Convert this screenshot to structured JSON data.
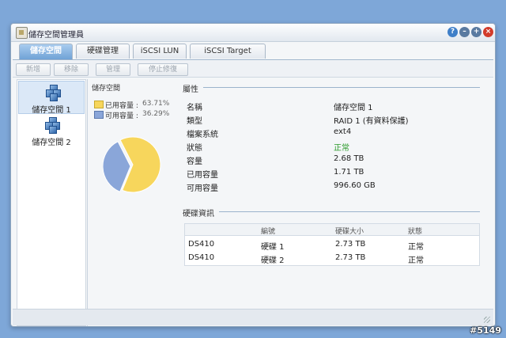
{
  "window": {
    "title": "儲存空間管理員"
  },
  "tabs": [
    {
      "label": "儲存空間"
    },
    {
      "label": "硬碟管理"
    },
    {
      "label": "iSCSI LUN"
    },
    {
      "label": "iSCSI Target"
    }
  ],
  "toolbar": {
    "create": "新增",
    "remove": "移除",
    "manage": "管理",
    "stop_repair": "停止修復"
  },
  "volumes": [
    {
      "label": "儲存空間 1"
    },
    {
      "label": "儲存空間 2"
    }
  ],
  "usage": {
    "title": "儲存空間",
    "used_label": "已用容量 :",
    "used_pct": "63.71%",
    "free_label": "可用容量 :",
    "free_pct": "36.29%",
    "used_color": "#f7d65c",
    "free_color": "#8aa6d9"
  },
  "properties": {
    "title": "屬性",
    "rows": [
      {
        "key": "名稱",
        "value": "儲存空間 1"
      },
      {
        "key": "類型",
        "value": "RAID 1 (有資料保護)"
      },
      {
        "key": "檔案系統",
        "value": "ext4"
      },
      {
        "key": "狀態",
        "value": "正常"
      },
      {
        "key": "容量",
        "value": "2.68 TB"
      },
      {
        "key": "已用容量",
        "value": "1.71 TB"
      },
      {
        "key": "可用容量",
        "value": "996.60 GB"
      }
    ]
  },
  "disks": {
    "title": "硬碟資訊",
    "headers": [
      "",
      "編號",
      "硬碟大小",
      "狀態"
    ],
    "rows": [
      [
        "DS410",
        "硬碟 1",
        "2.73 TB",
        "正常"
      ],
      [
        "DS410",
        "硬碟 2",
        "2.73 TB",
        "正常"
      ]
    ]
  },
  "watermark": "#5149"
}
